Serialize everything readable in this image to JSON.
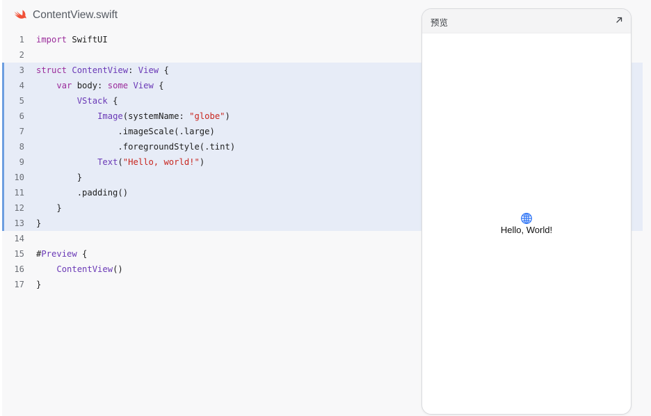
{
  "file": {
    "name": "ContentView.swift",
    "icon": "swift-icon"
  },
  "code": {
    "highlight_range": [
      3,
      13
    ],
    "lines": [
      {
        "n": "1",
        "tokens": [
          {
            "t": "import",
            "c": "kw"
          },
          {
            "t": " SwiftUI",
            "c": ""
          }
        ]
      },
      {
        "n": "2",
        "tokens": []
      },
      {
        "n": "3",
        "tokens": [
          {
            "t": "struct",
            "c": "kw"
          },
          {
            "t": " ",
            "c": ""
          },
          {
            "t": "ContentView",
            "c": "ty"
          },
          {
            "t": ": ",
            "c": ""
          },
          {
            "t": "View",
            "c": "ty"
          },
          {
            "t": " {",
            "c": ""
          }
        ]
      },
      {
        "n": "4",
        "tokens": [
          {
            "t": "    ",
            "c": ""
          },
          {
            "t": "var",
            "c": "kw"
          },
          {
            "t": " body: ",
            "c": ""
          },
          {
            "t": "some",
            "c": "kw"
          },
          {
            "t": " ",
            "c": ""
          },
          {
            "t": "View",
            "c": "ty"
          },
          {
            "t": " {",
            "c": ""
          }
        ]
      },
      {
        "n": "5",
        "tokens": [
          {
            "t": "        ",
            "c": ""
          },
          {
            "t": "VStack",
            "c": "ty"
          },
          {
            "t": " {",
            "c": ""
          }
        ]
      },
      {
        "n": "6",
        "tokens": [
          {
            "t": "            ",
            "c": ""
          },
          {
            "t": "Image",
            "c": "ty"
          },
          {
            "t": "(systemName: ",
            "c": ""
          },
          {
            "t": "\"globe\"",
            "c": "str"
          },
          {
            "t": ")",
            "c": ""
          }
        ]
      },
      {
        "n": "7",
        "tokens": [
          {
            "t": "                .imageScale(.large)",
            "c": ""
          }
        ]
      },
      {
        "n": "8",
        "tokens": [
          {
            "t": "                .foregroundStyle(.tint)",
            "c": ""
          }
        ]
      },
      {
        "n": "9",
        "tokens": [
          {
            "t": "            ",
            "c": ""
          },
          {
            "t": "Text",
            "c": "ty"
          },
          {
            "t": "(",
            "c": ""
          },
          {
            "t": "\"Hello, world!\"",
            "c": "str"
          },
          {
            "t": ")",
            "c": ""
          }
        ]
      },
      {
        "n": "10",
        "tokens": [
          {
            "t": "        }",
            "c": ""
          }
        ]
      },
      {
        "n": "11",
        "tokens": [
          {
            "t": "        .padding()",
            "c": ""
          }
        ]
      },
      {
        "n": "12",
        "tokens": [
          {
            "t": "    }",
            "c": ""
          }
        ]
      },
      {
        "n": "13",
        "tokens": [
          {
            "t": "}",
            "c": ""
          }
        ]
      },
      {
        "n": "14",
        "tokens": []
      },
      {
        "n": "15",
        "tokens": [
          {
            "t": "#",
            "c": ""
          },
          {
            "t": "Preview",
            "c": "fn"
          },
          {
            "t": " {",
            "c": ""
          }
        ]
      },
      {
        "n": "16",
        "tokens": [
          {
            "t": "    ",
            "c": ""
          },
          {
            "t": "ContentView",
            "c": "ty"
          },
          {
            "t": "()",
            "c": ""
          }
        ]
      },
      {
        "n": "17",
        "tokens": [
          {
            "t": "}",
            "c": ""
          }
        ]
      }
    ]
  },
  "preview": {
    "title": "预览",
    "expand_icon": "expand-arrow-icon",
    "content": {
      "icon": "globe-icon",
      "text": "Hello, World!"
    }
  },
  "colors": {
    "highlight_bg": "#e7ecf7",
    "highlight_bar": "#6d9ee0",
    "accent": "#3478f6",
    "swift": "#f05138"
  }
}
